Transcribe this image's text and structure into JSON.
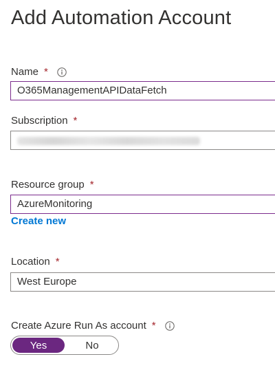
{
  "page": {
    "title": "Add Automation Account"
  },
  "form": {
    "name": {
      "label": "Name",
      "required_mark": "*",
      "value": "O365ManagementAPIDataFetch"
    },
    "subscription": {
      "label": "Subscription",
      "required_mark": "*"
    },
    "resource_group": {
      "label": "Resource group",
      "required_mark": "*",
      "value": "AzureMonitoring",
      "create_new_label": "Create new"
    },
    "location": {
      "label": "Location",
      "required_mark": "*",
      "value": "West Europe"
    },
    "run_as": {
      "label": "Create Azure Run As account",
      "required_mark": "*",
      "options": [
        "Yes",
        "No"
      ],
      "selected": "Yes"
    }
  },
  "colors": {
    "required": "#a4262c",
    "link": "#0078d4",
    "toggle_selected": "#6b2780",
    "active_border": "#7a2a8c"
  },
  "icons": {
    "name_info": "info-icon",
    "run_as_info": "info-icon"
  }
}
